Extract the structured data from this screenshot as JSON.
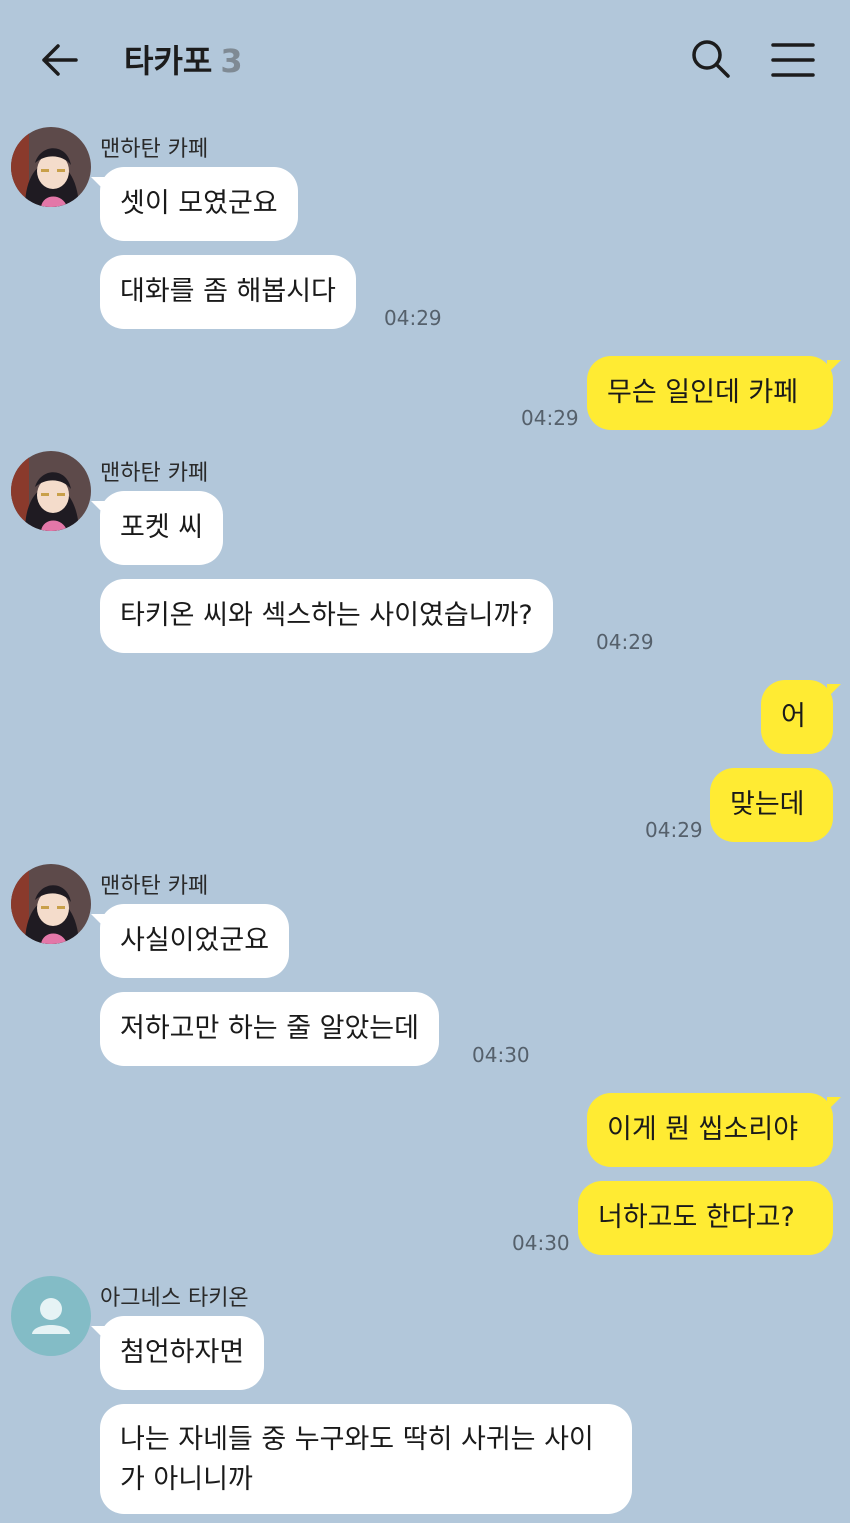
{
  "header": {
    "title": "타카포",
    "member_count": "3",
    "icons": {
      "back": "arrow-left-icon",
      "search": "search-icon",
      "menu": "hamburger-menu-icon"
    }
  },
  "colors": {
    "background": "#b2c7da",
    "incoming_bubble": "#ffffff",
    "outgoing_bubble": "#ffeb33"
  },
  "messages": [
    {
      "sender": "맨하탄 카페",
      "text": "셋이 모였군요"
    },
    {
      "text": "대화를 좀 해봅시다",
      "time": "04:29"
    },
    {
      "text": "무슨 일인데 카페",
      "time": "04:29"
    },
    {
      "sender": "맨하탄 카페",
      "text": "포켓 씨"
    },
    {
      "text": "타키온 씨와 섹스하는 사이였습니까?",
      "time": "04:29"
    },
    {
      "text": "어"
    },
    {
      "text": "맞는데",
      "time": "04:29"
    },
    {
      "sender": "맨하탄 카페",
      "text": "사실이었군요"
    },
    {
      "text": "저하고만 하는 줄 알았는데",
      "time": "04:30"
    },
    {
      "text": "이게 뭔 씹소리야"
    },
    {
      "text": "너하고도 한다고?",
      "time": "04:30"
    },
    {
      "sender": "아그네스 타키온",
      "text": "첨언하자면"
    },
    {
      "text": "나는 자네들 중 누구와도 딱히 사귀는 사이가 아니니까"
    }
  ]
}
